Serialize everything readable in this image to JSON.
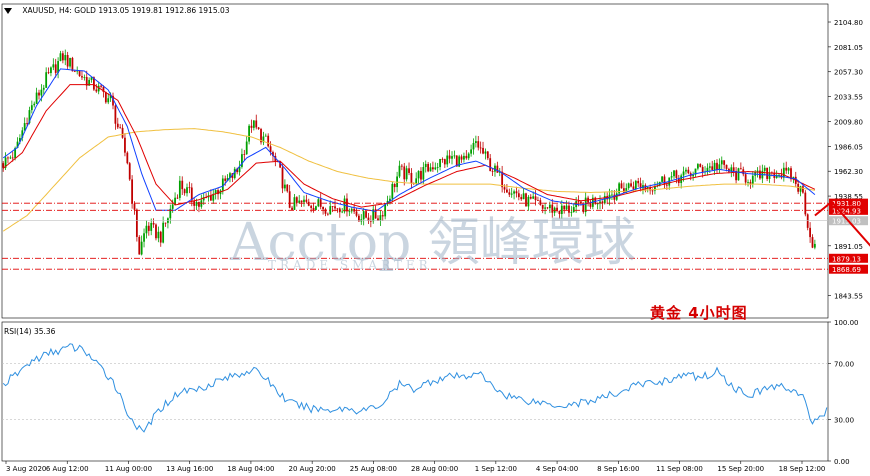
{
  "header": {
    "symbol_line": "XAUUSD, H4:  GOLD  1913.05 1919.81 1912.86 1915.03"
  },
  "rsi_header": "RSI(14) 35.36",
  "annotation": {
    "label": "黄金   4小时图"
  },
  "watermark": {
    "brand": "Acctop 領峰環球",
    "sub": "TRADE SMARTER"
  },
  "colors": {
    "bull": "#00a000",
    "bear": "#c00000",
    "ma_fast": "#1040ff",
    "ma_mid": "#e00000",
    "ma_slow": "#f0c040",
    "rsi": "#3090e0",
    "level_line": "#e00000",
    "price_box": "#e00000",
    "current_box": "#c0c0c0"
  },
  "chart_data": [
    {
      "type": "candlestick",
      "title": "XAUUSD, H4: GOLD",
      "ylim": [
        1822.1,
        2122.0
      ],
      "y_ticks": [
        "2104.80",
        "2081.05",
        "2057.30",
        "2033.55",
        "2009.80",
        "1986.05",
        "1962.30",
        "1938.55",
        "1891.05",
        "1843.55"
      ],
      "x_ticks": [
        "3 Aug 2020",
        "6 Aug 12:00",
        "11 Aug 00:00",
        "13 Aug 16:00",
        "18 Aug 04:00",
        "20 Aug 20:00",
        "25 Aug 08:00",
        "28 Aug 00:00",
        "1 Sep 12:00",
        "4 Sep 04:00",
        "8 Sep 16:00",
        "11 Sep 08:00",
        "15 Sep 20:00",
        "18 Sep 12:00"
      ],
      "close_anchors": [
        [
          0,
          1970
        ],
        [
          5,
          1980
        ],
        [
          10,
          2015
        ],
        [
          18,
          2050
        ],
        [
          25,
          2072
        ],
        [
          32,
          2055
        ],
        [
          40,
          2040
        ],
        [
          45,
          2030
        ],
        [
          52,
          1972
        ],
        [
          57,
          1885
        ],
        [
          60,
          1910
        ],
        [
          66,
          1900
        ],
        [
          74,
          1950
        ],
        [
          82,
          1930
        ],
        [
          90,
          1945
        ],
        [
          98,
          1962
        ],
        [
          104,
          2008
        ],
        [
          110,
          1990
        ],
        [
          116,
          1960
        ],
        [
          120,
          1930
        ],
        [
          128,
          1932
        ],
        [
          136,
          1928
        ],
        [
          144,
          1930
        ],
        [
          150,
          1918
        ],
        [
          158,
          1920
        ],
        [
          166,
          1962
        ],
        [
          172,
          1955
        ],
        [
          180,
          1968
        ],
        [
          188,
          1975
        ],
        [
          194,
          1970
        ],
        [
          198,
          1990
        ],
        [
          204,
          1968
        ],
        [
          210,
          1950
        ],
        [
          218,
          1935
        ],
        [
          226,
          1928
        ],
        [
          234,
          1925
        ],
        [
          242,
          1928
        ],
        [
          248,
          1935
        ],
        [
          256,
          1942
        ],
        [
          264,
          1950
        ],
        [
          270,
          1948
        ],
        [
          278,
          1955
        ],
        [
          286,
          1958
        ],
        [
          292,
          1965
        ],
        [
          300,
          1968
        ],
        [
          306,
          1960
        ],
        [
          314,
          1955
        ],
        [
          322,
          1962
        ],
        [
          330,
          1958
        ],
        [
          335,
          1940
        ],
        [
          338,
          1900
        ],
        [
          340,
          1890
        ]
      ],
      "ma_fast_anchors": [
        [
          0,
          1975
        ],
        [
          6,
          1985
        ],
        [
          14,
          2025
        ],
        [
          24,
          2060
        ],
        [
          34,
          2058
        ],
        [
          44,
          2040
        ],
        [
          52,
          2005
        ],
        [
          58,
          1960
        ],
        [
          64,
          1925
        ],
        [
          72,
          1925
        ],
        [
          82,
          1940
        ],
        [
          92,
          1948
        ],
        [
          102,
          1975
        ],
        [
          110,
          1985
        ],
        [
          118,
          1965
        ],
        [
          126,
          1942
        ],
        [
          136,
          1934
        ],
        [
          146,
          1928
        ],
        [
          156,
          1924
        ],
        [
          166,
          1940
        ],
        [
          178,
          1955
        ],
        [
          190,
          1968
        ],
        [
          198,
          1972
        ],
        [
          208,
          1962
        ],
        [
          218,
          1946
        ],
        [
          230,
          1934
        ],
        [
          242,
          1930
        ],
        [
          254,
          1937
        ],
        [
          266,
          1946
        ],
        [
          278,
          1952
        ],
        [
          290,
          1960
        ],
        [
          300,
          1964
        ],
        [
          312,
          1960
        ],
        [
          324,
          1958
        ],
        [
          332,
          1955
        ],
        [
          340,
          1940
        ]
      ],
      "ma_mid_anchors": [
        [
          0,
          1965
        ],
        [
          8,
          1980
        ],
        [
          18,
          2020
        ],
        [
          28,
          2045
        ],
        [
          38,
          2045
        ],
        [
          48,
          2030
        ],
        [
          56,
          1995
        ],
        [
          64,
          1950
        ],
        [
          72,
          1930
        ],
        [
          82,
          1935
        ],
        [
          94,
          1945
        ],
        [
          106,
          1970
        ],
        [
          116,
          1972
        ],
        [
          126,
          1950
        ],
        [
          138,
          1936
        ],
        [
          150,
          1928
        ],
        [
          162,
          1932
        ],
        [
          176,
          1948
        ],
        [
          190,
          1962
        ],
        [
          202,
          1968
        ],
        [
          214,
          1956
        ],
        [
          228,
          1940
        ],
        [
          242,
          1934
        ],
        [
          256,
          1938
        ],
        [
          270,
          1946
        ],
        [
          284,
          1954
        ],
        [
          298,
          1960
        ],
        [
          312,
          1962
        ],
        [
          326,
          1960
        ],
        [
          340,
          1945
        ]
      ],
      "ma_slow_anchors": [
        [
          0,
          1905
        ],
        [
          10,
          1920
        ],
        [
          20,
          1945
        ],
        [
          32,
          1975
        ],
        [
          44,
          1995
        ],
        [
          56,
          2000
        ],
        [
          68,
          2002
        ],
        [
          80,
          2003
        ],
        [
          92,
          2000
        ],
        [
          104,
          1995
        ],
        [
          116,
          1985
        ],
        [
          128,
          1972
        ],
        [
          140,
          1962
        ],
        [
          152,
          1956
        ],
        [
          164,
          1952
        ],
        [
          176,
          1950
        ],
        [
          190,
          1950
        ],
        [
          204,
          1950
        ],
        [
          218,
          1946
        ],
        [
          232,
          1943
        ],
        [
          246,
          1942
        ],
        [
          260,
          1943
        ],
        [
          274,
          1945
        ],
        [
          288,
          1948
        ],
        [
          302,
          1950
        ],
        [
          316,
          1950
        ],
        [
          330,
          1948
        ],
        [
          340,
          1944
        ]
      ],
      "levels": [
        {
          "price": 1931.8,
          "label": "1931.80"
        },
        {
          "price": 1924.93,
          "label": "1924.93"
        },
        {
          "price": 1879.13,
          "label": "1879.13"
        },
        {
          "price": 1868.69,
          "label": "1868.69"
        }
      ],
      "current_price": {
        "price": 1915.03,
        "label": "1915.03"
      },
      "forecast_path": [
        [
          340,
          1920
        ],
        [
          347,
          1933
        ],
        [
          368,
          1879
        ]
      ]
    },
    {
      "type": "line",
      "title": "RSI(14) 35.36",
      "ylim": [
        0,
        100
      ],
      "y_ticks": [
        "100.00",
        "70.00",
        "30.00",
        "0.00"
      ],
      "levels": [
        70,
        30
      ],
      "series": [
        {
          "values_anchors": [
            [
              0,
              55
            ],
            [
              6,
              63
            ],
            [
              12,
              72
            ],
            [
              20,
              78
            ],
            [
              28,
              82
            ],
            [
              34,
              80
            ],
            [
              40,
              68
            ],
            [
              46,
              58
            ],
            [
              52,
              35
            ],
            [
              58,
              20
            ],
            [
              60,
              24
            ],
            [
              66,
              38
            ],
            [
              74,
              50
            ],
            [
              82,
              52
            ],
            [
              90,
              58
            ],
            [
              98,
              62
            ],
            [
              104,
              66
            ],
            [
              110,
              60
            ],
            [
              116,
              48
            ],
            [
              120,
              42
            ],
            [
              128,
              38
            ],
            [
              136,
              37
            ],
            [
              144,
              38
            ],
            [
              150,
              36
            ],
            [
              158,
              40
            ],
            [
              166,
              55
            ],
            [
              172,
              52
            ],
            [
              180,
              58
            ],
            [
              188,
              61
            ],
            [
              194,
              60
            ],
            [
              198,
              65
            ],
            [
              204,
              55
            ],
            [
              210,
              48
            ],
            [
              218,
              44
            ],
            [
              226,
              42
            ],
            [
              234,
              40
            ],
            [
              242,
              42
            ],
            [
              248,
              44
            ],
            [
              256,
              48
            ],
            [
              264,
              54
            ],
            [
              270,
              56
            ],
            [
              278,
              58
            ],
            [
              286,
              62
            ],
            [
              292,
              60
            ],
            [
              300,
              65
            ],
            [
              306,
              52
            ],
            [
              314,
              48
            ],
            [
              322,
              54
            ],
            [
              330,
              52
            ],
            [
              335,
              46
            ],
            [
              338,
              30
            ],
            [
              340,
              28
            ],
            [
              343,
              34
            ],
            [
              345,
              36
            ]
          ]
        }
      ]
    }
  ]
}
